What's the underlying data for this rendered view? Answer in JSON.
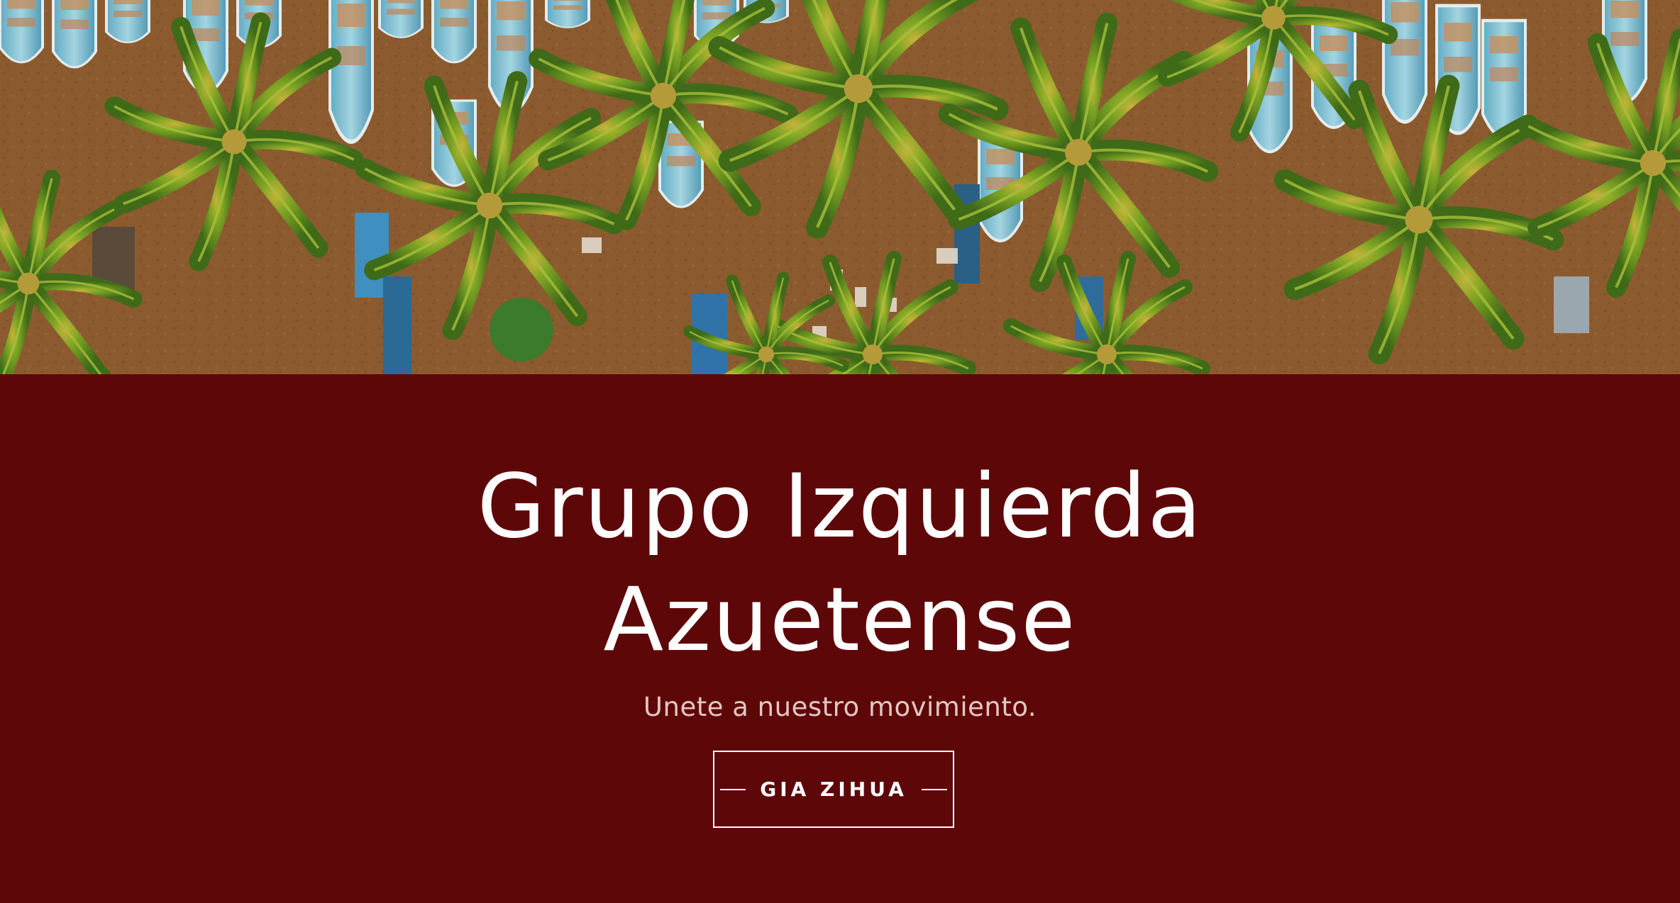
{
  "hero": {
    "image_description": "aerial-beach-boats-palms",
    "colors": {
      "sand": "#8a5a2e",
      "boat_light": "#8ec9da",
      "boat_dark": "#2a7fb0",
      "palm": "#6f9a1f",
      "panel": "#5e0709"
    }
  },
  "content": {
    "title_line_1": "Grupo Izquierda",
    "title_line_2": "Azuetense",
    "subtitle": "Unete a nuestro movimiento.",
    "cta_label": "GIA ZIHUA"
  }
}
